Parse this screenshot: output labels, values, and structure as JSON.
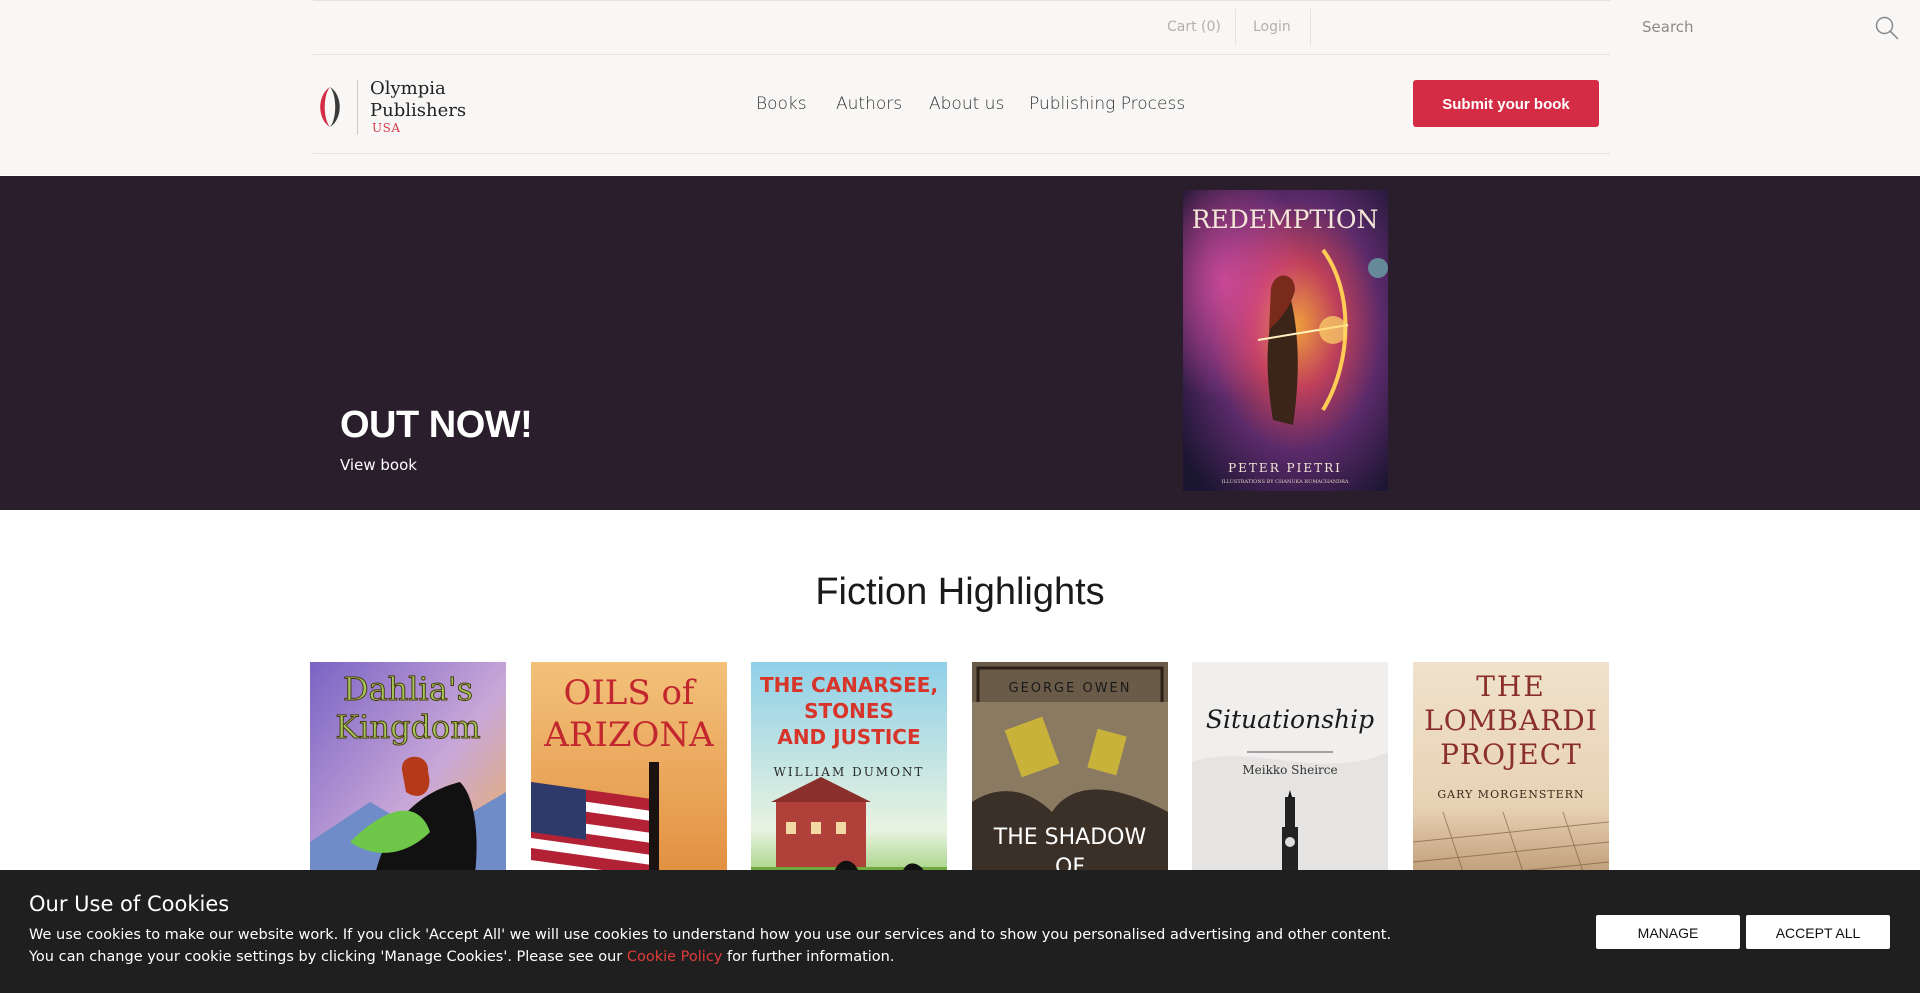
{
  "header": {
    "cart": "Cart (0)",
    "login": "Login",
    "search_placeholder": "Search",
    "logo_line1": "Olympia",
    "logo_line2": "Publishers",
    "logo_sub": "USA",
    "nav": [
      "Books",
      "Authors",
      "About us",
      "Publishing Process"
    ],
    "submit_button": "Submit your book",
    "colors": {
      "accent": "#d42c45",
      "background": "#f8f7f6"
    }
  },
  "hero": {
    "title": "OUT NOW!",
    "link": "View book",
    "book_title": "REDEMPTION",
    "book_author": "PETER PIETRI",
    "book_credit": "ILLUSTRATIONS BY CHANUKA RUMACHANDRA",
    "background": "#2a1d2c"
  },
  "fiction": {
    "title": "Fiction Highlights",
    "books": [
      {
        "title_l1": "Dahlia's",
        "title_l2": "Kingdom"
      },
      {
        "title_l1": "OILS of",
        "title_l2": "ARIZONA"
      },
      {
        "title_l1": "THE CANARSEE,",
        "title_l2": "STONES",
        "title_l3": "AND JUSTICE",
        "author": "WILLIAM DUMONT"
      },
      {
        "author": "GEORGE OWEN",
        "title_l1": "THE SHADOW",
        "title_l2": "OF"
      },
      {
        "title_l1": "Situationship",
        "author": "Meikko Sheirce"
      },
      {
        "title_l1": "THE",
        "title_l2": "LOMBARDI",
        "title_l3": "PROJECT",
        "author": "GARY MORGENSTERN"
      }
    ]
  },
  "cookie": {
    "title": "Our Use of Cookies",
    "line1": "We use cookies to make our website work. If you click 'Accept All' we will use cookies to understand how you use our services and to show you personalised advertising and other content.",
    "line2_prefix": "You can change your cookie settings by clicking 'Manage Cookies'. Please see our ",
    "policy_link": "Cookie Policy",
    "line2_suffix": " for further information.",
    "manage": "MANAGE",
    "accept": "ACCEPT ALL"
  }
}
